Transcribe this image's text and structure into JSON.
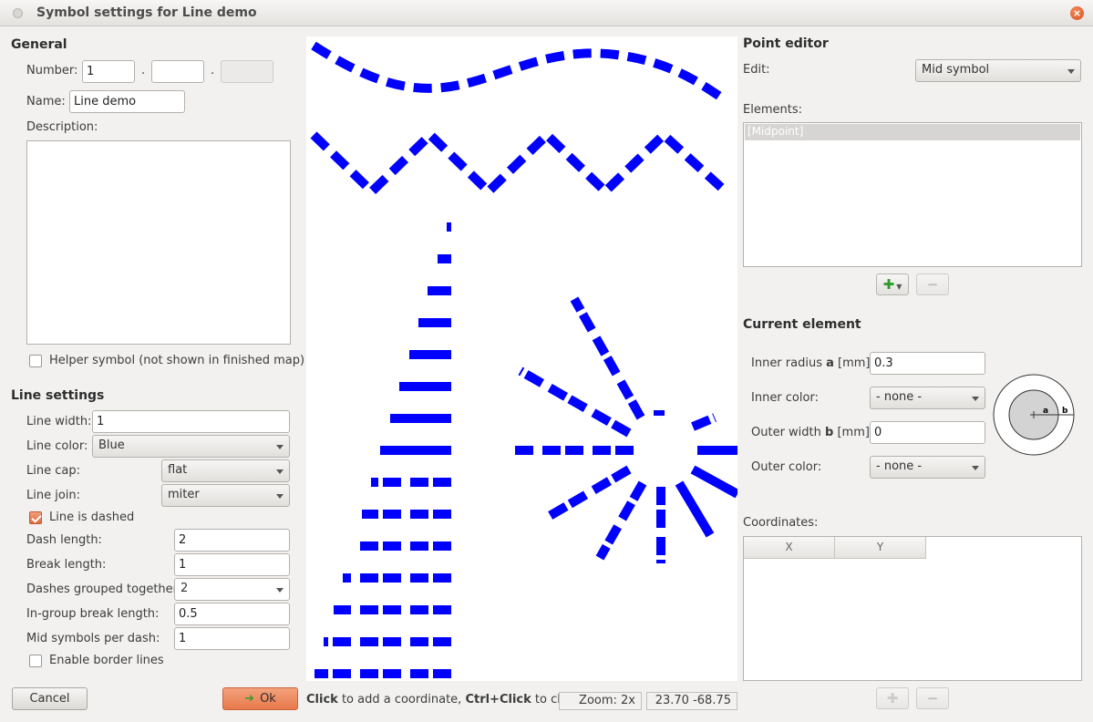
{
  "window": {
    "title": "Symbol settings for Line demo"
  },
  "general": {
    "heading": "General",
    "number_label": "Number:",
    "number_values": [
      "1",
      "",
      ""
    ],
    "number_sep": ".",
    "name_label": "Name:",
    "name_value": "Line demo",
    "description_label": "Description:",
    "helper_label": "Helper symbol (not shown in finished map)",
    "helper_checked": false
  },
  "line_settings": {
    "heading": "Line settings",
    "line_width_label": "Line width:",
    "line_width": "1",
    "line_color_label": "Line color:",
    "line_color": "Blue",
    "line_cap_label": "Line cap:",
    "line_cap": "flat",
    "line_join_label": "Line join:",
    "line_join": "miter",
    "dashed_label": "Line is dashed",
    "dashed_checked": true,
    "dash_length_label": "Dash length:",
    "dash_length": "2",
    "break_length_label": "Break length:",
    "break_length": "1",
    "grouped_label": "Dashes grouped together:",
    "grouped": "2",
    "in_group_label": "In-group break length:",
    "in_group": "0.5",
    "mid_symbols_label": "Mid symbols per dash:",
    "mid_symbols": "1",
    "border_label": "Enable border lines",
    "border_checked": false
  },
  "buttons": {
    "cancel": "Cancel",
    "ok": "Ok",
    "ok_icon": "ok-check-icon"
  },
  "status": {
    "hint_bold1": "Click",
    "hint_text1": " to add a coordinate, ",
    "hint_bold2": "Ctrl+Click",
    "hint_text2": " to chan",
    "zoom": "Zoom: 2x",
    "coords": "23.70 -68.75"
  },
  "point_editor": {
    "heading": "Point editor",
    "edit_label": "Edit:",
    "edit_value": "Mid symbol",
    "elements_label": "Elements:",
    "elements": [
      "[Midpoint]"
    ]
  },
  "current_element": {
    "heading": "Current element",
    "inner_radius_label_pre": "Inner radius ",
    "inner_radius_label_bold": "a",
    "inner_radius_label_post": " [mm]:",
    "inner_radius": "0.3",
    "inner_color_label": "Inner color:",
    "inner_color": "- none -",
    "outer_width_label_pre": "Outer width ",
    "outer_width_label_bold": "b",
    "outer_width_label_post": " [mm]:",
    "outer_width": "0",
    "outer_color_label": "Outer color:",
    "outer_color": "- none -",
    "diagram_a": "a",
    "diagram_b": "b"
  },
  "coordinates": {
    "label": "Coordinates:",
    "columns": [
      "X",
      "Y"
    ]
  },
  "colors": {
    "symbol_blue": "#0000ff",
    "accent": "#e8794b"
  }
}
